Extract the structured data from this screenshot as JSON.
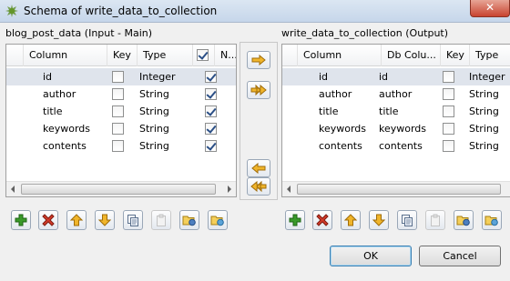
{
  "window": {
    "title": "Schema of write_data_to_collection",
    "close_glyph": "✕"
  },
  "input_panel": {
    "label": "blog_post_data (Input - Main)",
    "headers": [
      "Column",
      "Key",
      "Type",
      "N..."
    ],
    "header_nullable_checked": true,
    "rows": [
      {
        "column": "id",
        "key": false,
        "type": "Integer",
        "nullable": true
      },
      {
        "column": "author",
        "key": false,
        "type": "String",
        "nullable": true
      },
      {
        "column": "title",
        "key": false,
        "type": "String",
        "nullable": true
      },
      {
        "column": "keywords",
        "key": false,
        "type": "String",
        "nullable": true
      },
      {
        "column": "contents",
        "key": false,
        "type": "String",
        "nullable": true
      }
    ]
  },
  "output_panel": {
    "label": "write_data_to_collection (Output)",
    "headers": [
      "Column",
      "Db Colu...",
      "Key",
      "Type"
    ],
    "rows": [
      {
        "column": "id",
        "db_column": "id",
        "key": false,
        "type": "Integer"
      },
      {
        "column": "author",
        "db_column": "author",
        "key": false,
        "type": "String"
      },
      {
        "column": "title",
        "db_column": "title",
        "key": false,
        "type": "String"
      },
      {
        "column": "keywords",
        "db_column": "keywords",
        "key": false,
        "type": "String"
      },
      {
        "column": "contents",
        "db_column": "contents",
        "key": false,
        "type": "String"
      }
    ]
  },
  "toolbar_icons": [
    "add-icon",
    "remove-icon",
    "move-up-icon",
    "move-down-icon",
    "copy-icon",
    "paste-icon",
    "import-schema-icon",
    "export-schema-icon"
  ],
  "colors": {
    "add": "#3a9a2a",
    "remove": "#c0392b",
    "arrow": "#e3a321",
    "selected_row": "#dfe4ec"
  },
  "buttons": {
    "ok": "OK",
    "cancel": "Cancel"
  }
}
